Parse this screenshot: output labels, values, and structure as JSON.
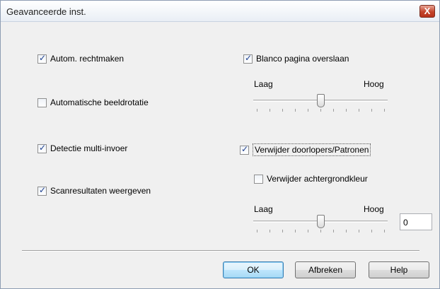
{
  "window": {
    "title": "Geavanceerde inst.",
    "close_label": "X"
  },
  "options": {
    "autom_rechtmaken": {
      "label": "Autom. rechtmaken",
      "checked": true
    },
    "automatische_beeldrotatie": {
      "label": "Automatische beeldrotatie",
      "checked": false
    },
    "detectie_multi_invoer": {
      "label": "Detectie multi-invoer",
      "checked": true
    },
    "scanresultaten_weergeven": {
      "label": "Scanresultaten weergeven",
      "checked": true
    },
    "blanco_pagina_overslaan": {
      "label": "Blanco pagina overslaan",
      "checked": true
    },
    "verwijder_doorlopers": {
      "label": "Verwijder doorlopers/Patronen",
      "checked": true
    },
    "verwijder_achtergrondkleur": {
      "label": "Verwijder achtergrondkleur",
      "checked": false
    }
  },
  "slider_blank_page": {
    "low_label": "Laag",
    "high_label": "Hoog",
    "level": 0.5
  },
  "slider_background": {
    "low_label": "Laag",
    "high_label": "Hoog",
    "level": 0.5,
    "value": "0"
  },
  "buttons": {
    "ok": "OK",
    "cancel": "Afbreken",
    "help": "Help"
  }
}
